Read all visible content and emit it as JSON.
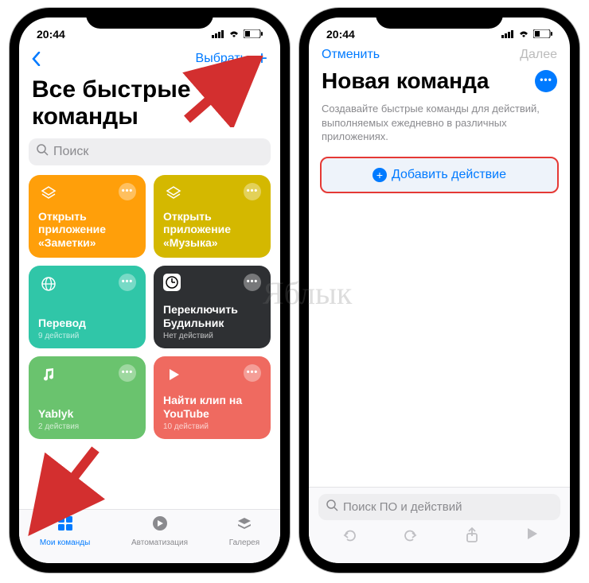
{
  "statusbar": {
    "time": "20:44"
  },
  "phone1": {
    "nav": {
      "select": "Выбрать"
    },
    "title": "Все быстрые команды",
    "search_placeholder": "Поиск",
    "cards": [
      {
        "title": "Открыть приложение «Заметки»",
        "sub": ""
      },
      {
        "title": "Открыть приложение «Музыка»",
        "sub": ""
      },
      {
        "title": "Перевод",
        "sub": "9 действий"
      },
      {
        "title": "Переключить Будильник",
        "sub": "Нет действий"
      },
      {
        "title": "Yablyk",
        "sub": "2 действия"
      },
      {
        "title": "Найти клип на YouTube",
        "sub": "10 действий"
      }
    ],
    "tabs": {
      "my": "Мои команды",
      "automation": "Автоматизация",
      "gallery": "Галерея"
    }
  },
  "phone2": {
    "nav": {
      "cancel": "Отменить",
      "next": "Далее"
    },
    "title": "Новая команда",
    "desc": "Создавайте быстрые команды для действий, выполняемых ежедневно в различных приложениях.",
    "add_action": "Добавить действие",
    "search_placeholder": "Поиск ПО и действий"
  },
  "watermark": "Яблык"
}
